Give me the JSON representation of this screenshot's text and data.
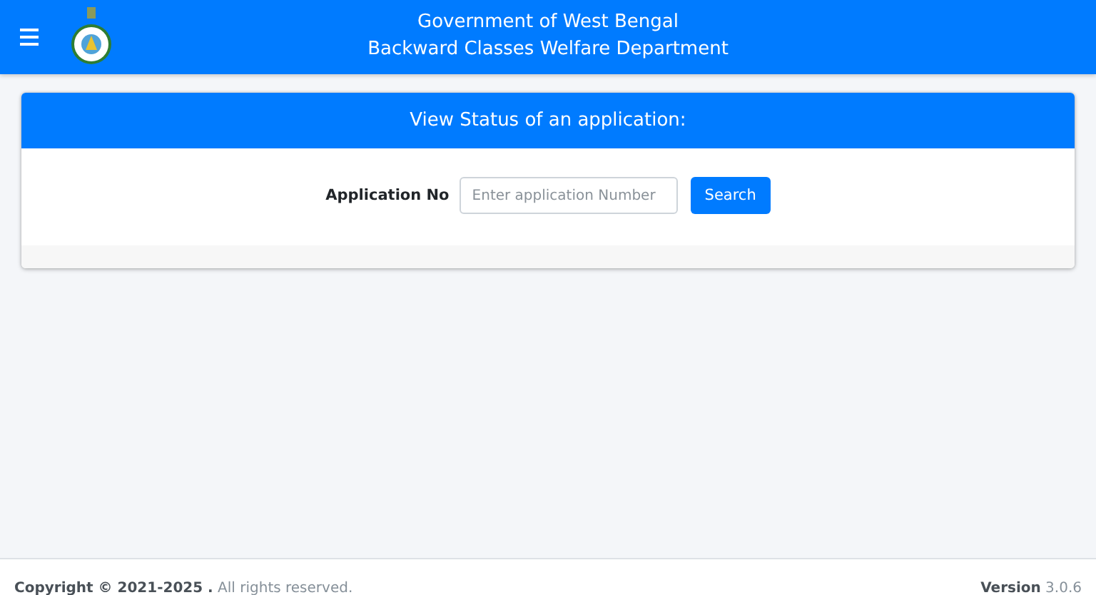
{
  "header": {
    "title_lines": [
      "Government of West Bengal",
      "Backward Classes Welfare Department"
    ]
  },
  "card": {
    "title": "View Status of an application:",
    "field_label": "Application No",
    "placeholder": "Enter application Number",
    "button": "Search"
  },
  "footer": {
    "copyright": "**Copyright © 2021-2025 .** All rights reserved.",
    "version": "**Version** 3.0.6"
  }
}
